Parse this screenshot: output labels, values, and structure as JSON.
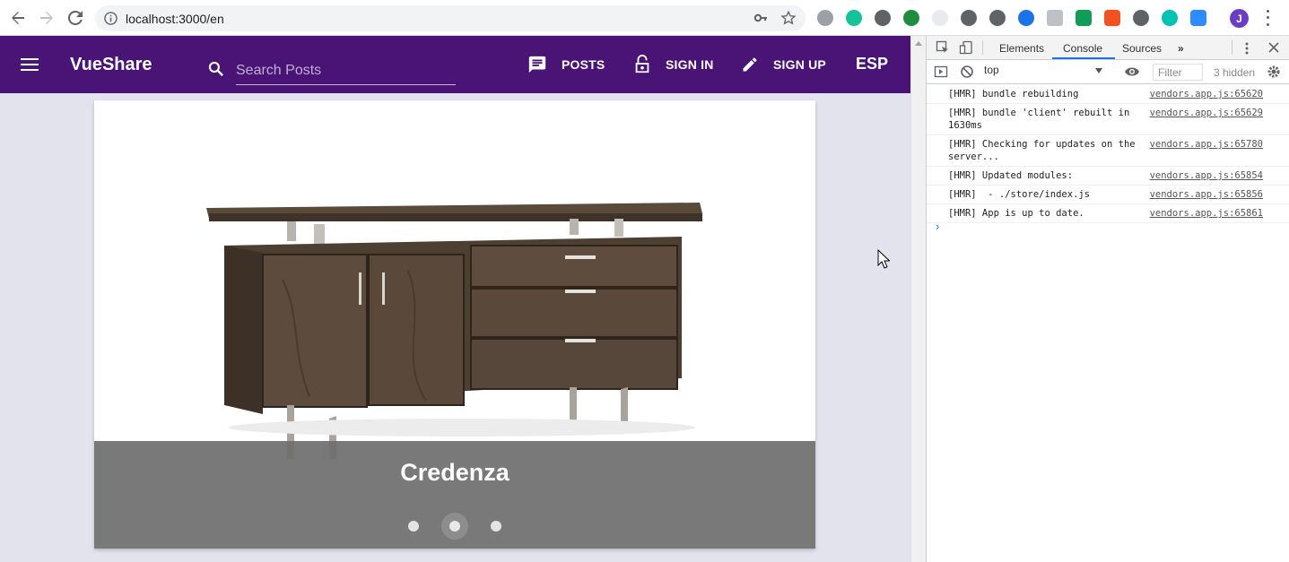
{
  "browser": {
    "url": "localhost:3000/en",
    "profile_initial": "J",
    "extension_colors": [
      "#9aa0a6",
      "#15c39a",
      "#5f6368",
      "#1e8e3e",
      "#e8eaed",
      "#5f6368",
      "#5f6368",
      "#1a73e8",
      "#bdc1c6",
      "#0f9d58",
      "#f4511e",
      "#5f6368",
      "#00c4b3",
      "#2d8cff"
    ]
  },
  "app": {
    "brand": "VueShare",
    "search_placeholder": "Search Posts",
    "nav": {
      "posts": "POSTS",
      "sign_in": "SIGN IN",
      "sign_up": "SIGN UP",
      "language": "ESP"
    },
    "theme_color": "#4a1476"
  },
  "carousel": {
    "caption": "Credenza",
    "slide_count": 3,
    "active_index": 1
  },
  "devtools": {
    "tabs": [
      "Elements",
      "Console",
      "Sources"
    ],
    "active_tab": "Console",
    "context": "top",
    "filter_placeholder": "Filter",
    "hidden": "3 hidden",
    "console": [
      {
        "msg": "[HMR] bundle rebuilding",
        "src": "vendors.app.js:65620"
      },
      {
        "msg": "[HMR] bundle 'client' rebuilt in 1630ms",
        "src": "vendors.app.js:65629"
      },
      {
        "msg": "[HMR] Checking for updates on the server...",
        "src": "vendors.app.js:65780"
      },
      {
        "msg": "[HMR] Updated modules:",
        "src": "vendors.app.js:65854"
      },
      {
        "msg": "[HMR]  - ./store/index.js",
        "src": "vendors.app.js:65856"
      },
      {
        "msg": "[HMR] App is up to date.",
        "src": "vendors.app.js:65861"
      }
    ]
  }
}
